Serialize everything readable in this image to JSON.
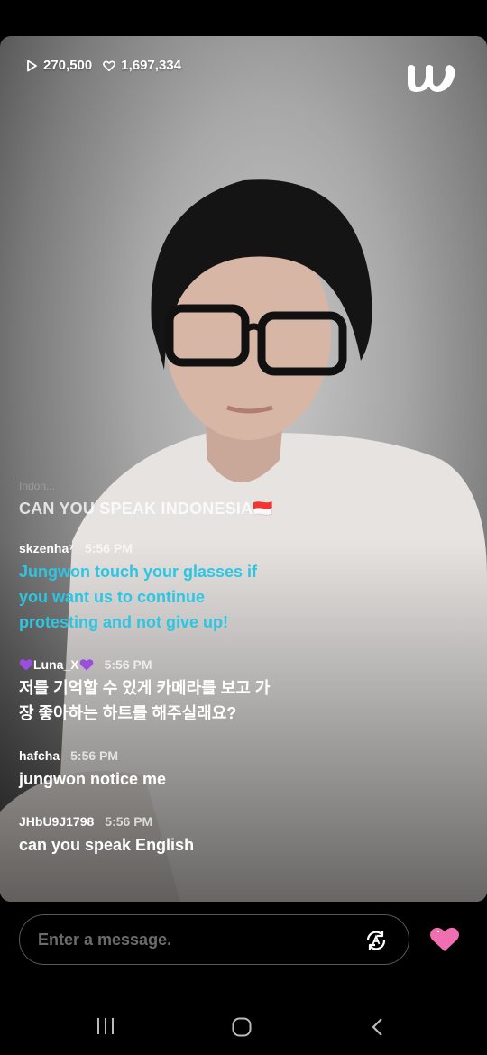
{
  "stats": {
    "plays": "270,500",
    "likes": "1,697,334"
  },
  "chat": {
    "faded_line": "Indon...",
    "top_message": "CAN YOU SPEAK INDONESIA🇮🇩",
    "messages": [
      {
        "user": "skzenha⁷",
        "time": "5:56 PM",
        "text_lines": [
          "Jungwon touch your glasses if",
          "you want us to continue",
          "protesting and not give up!"
        ]
      },
      {
        "user": "Luna_X",
        "time": "5:56 PM",
        "text_lines": [
          "저를 기억할 수 있게 카메라를 보고 가",
          "장 좋아하는 하트를 해주실래요?"
        ]
      },
      {
        "user": "hafcha",
        "time": "5:56 PM",
        "text_lines": [
          "jungwon notice me"
        ]
      },
      {
        "user": "JHbU9J1798",
        "time": "5:56 PM",
        "text_lines": [
          "can you speak English"
        ]
      }
    ]
  },
  "input": {
    "placeholder": "Enter a message."
  },
  "icons": {
    "play": "play-icon",
    "heart": "heart-outline-icon",
    "logo": "weverse-logo",
    "translate": "translate-icon",
    "like": "pink-heart-icon",
    "nav": [
      "recent-apps-icon",
      "home-icon",
      "back-icon"
    ]
  },
  "colors": {
    "highlight_text": "#2cc6e3",
    "like_heart": "#f06fb0"
  }
}
